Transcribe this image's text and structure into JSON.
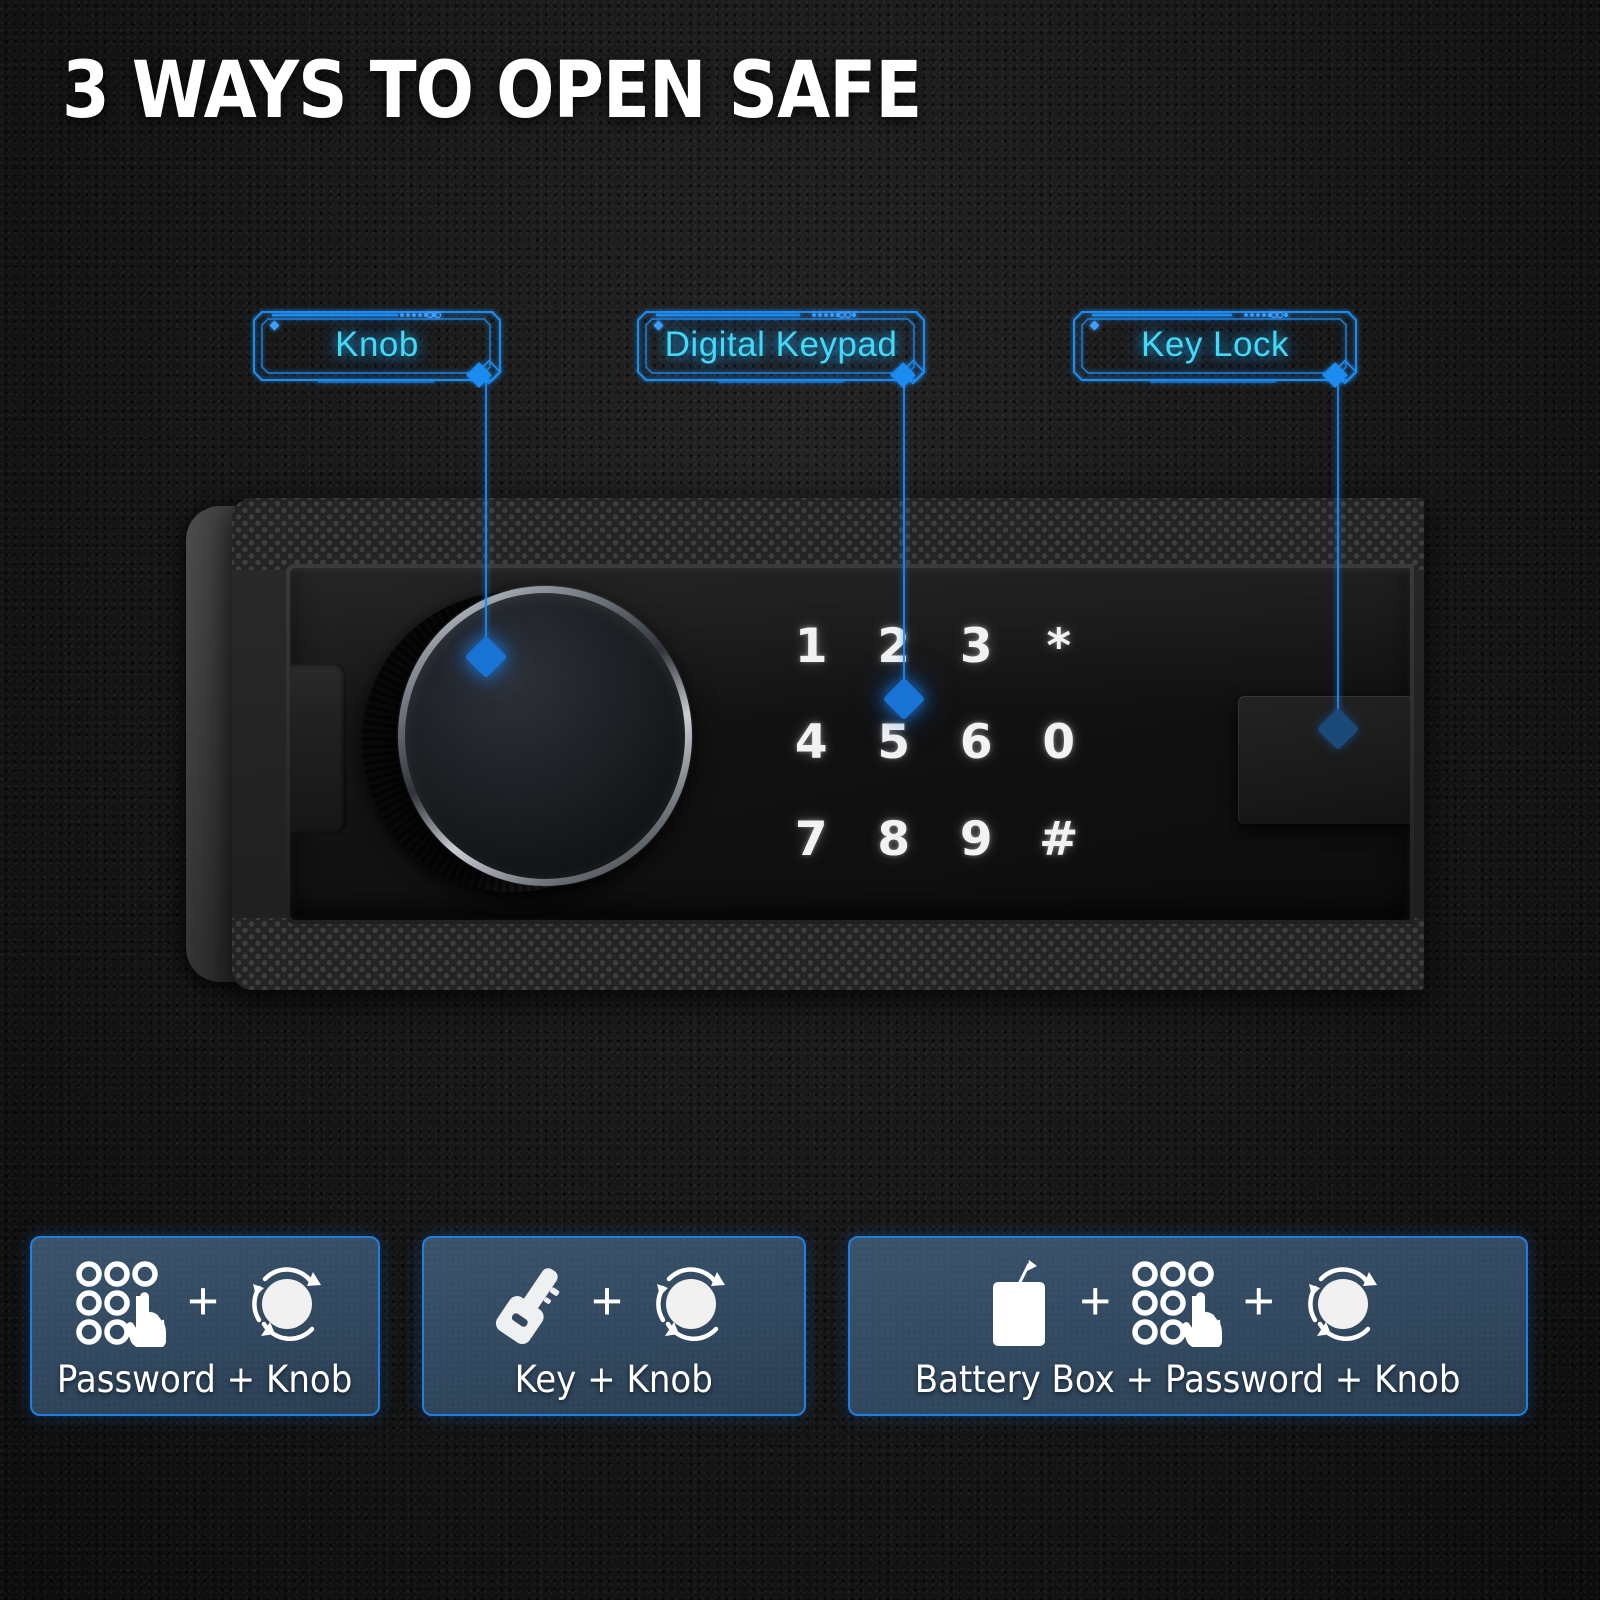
{
  "title": "3 WAYS TO OPEN SAFE",
  "colors": {
    "background": "#191919",
    "accent_blue": "#1f7fe0",
    "callout_text": "#42d9f5",
    "card_background": "#31485f",
    "key_text": "#f2f2f2"
  },
  "callouts": [
    {
      "label": "Knob",
      "target": "safe-knob"
    },
    {
      "label": "Digital Keypad",
      "target": "safe-keypad"
    },
    {
      "label": "Key Lock",
      "target": "safe-keylock"
    }
  ],
  "safe": {
    "keypad": {
      "rows": [
        [
          "1",
          "2",
          "3",
          "*"
        ],
        [
          "4",
          "5",
          "6",
          "0"
        ],
        [
          "7",
          "8",
          "9",
          "#"
        ]
      ]
    }
  },
  "cards": [
    {
      "label": "Password + Knob",
      "icons": [
        "keypad-finger-icon",
        "knob-rotate-icon"
      ],
      "separators": [
        "+"
      ]
    },
    {
      "label": "Key + Knob",
      "icons": [
        "key-icon",
        "knob-rotate-icon"
      ],
      "separators": [
        "+"
      ]
    },
    {
      "label": "Battery Box + Password + Knob",
      "icons": [
        "battery-box-icon",
        "keypad-finger-icon",
        "knob-rotate-icon"
      ],
      "separators": [
        "+",
        "+"
      ]
    }
  ],
  "plus_symbol": "+"
}
